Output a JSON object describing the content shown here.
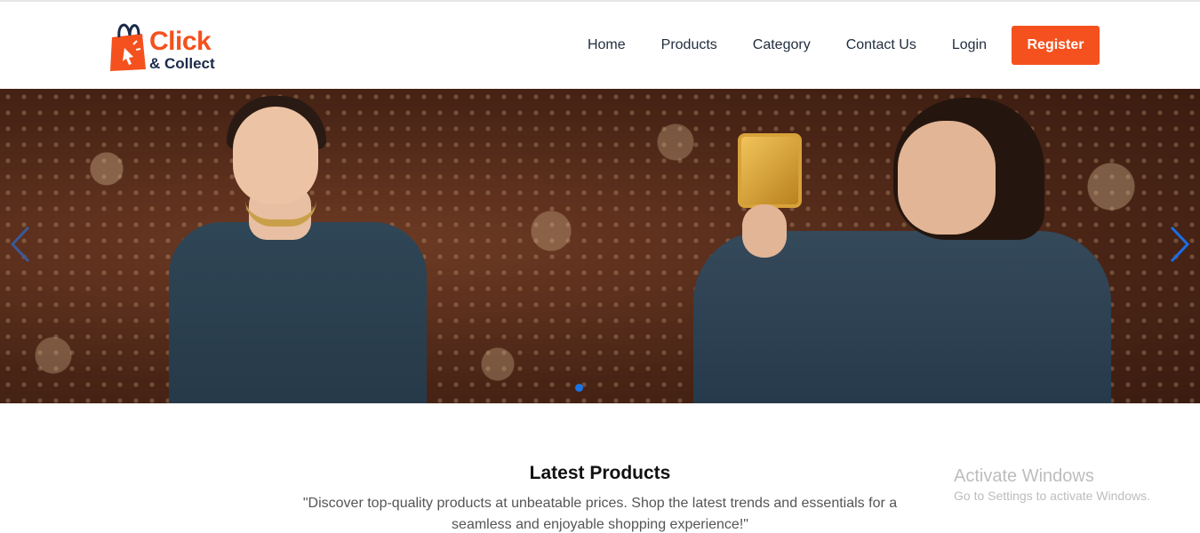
{
  "brand": {
    "logo_top": "Click",
    "logo_bottom": "& Collect",
    "primary_color": "#f4511e",
    "dark_color": "#1b2a4a"
  },
  "nav": {
    "items": [
      "Home",
      "Products",
      "Category",
      "Contact Us",
      "Login"
    ],
    "register_label": "Register"
  },
  "hero": {
    "slide_indicator_color": "#1a73e8",
    "prev_icon": "chevron-left-icon",
    "next_icon": "chevron-right-icon"
  },
  "latest": {
    "title": "Latest Products",
    "description": "\"Discover top-quality products at unbeatable prices. Shop the latest trends and essentials for a seamless and enjoyable shopping experience!\""
  },
  "watermark": {
    "title": "Activate Windows",
    "subtitle": "Go to Settings to activate Windows."
  }
}
